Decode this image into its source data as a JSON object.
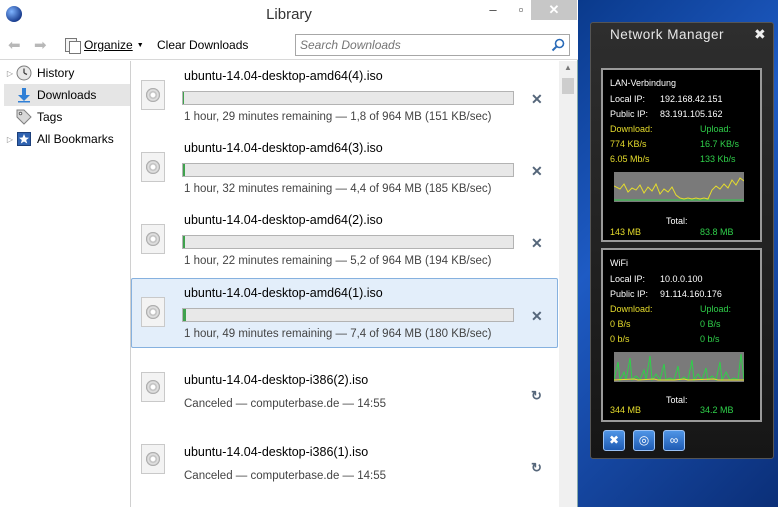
{
  "library": {
    "title": "Library",
    "window_controls": {
      "minimize": "–",
      "maximize": "▫",
      "close": "✕"
    },
    "toolbar": {
      "organize_label": "Organize",
      "clear_downloads_label": "Clear Downloads",
      "search_placeholder": "Search Downloads"
    },
    "sidebar": {
      "items": [
        {
          "label": "History",
          "icon": "history-clock-icon",
          "expandable": true,
          "selected": false
        },
        {
          "label": "Downloads",
          "icon": "download-arrow-icon",
          "expandable": false,
          "selected": true
        },
        {
          "label": "Tags",
          "icon": "tag-icon",
          "expandable": false,
          "selected": false
        },
        {
          "label": "All Bookmarks",
          "icon": "bookmark-star-icon",
          "expandable": true,
          "selected": false
        }
      ]
    },
    "downloads": [
      {
        "name": "ubuntu-14.04-desktop-amd64(4).iso",
        "status": "1 hour, 29 minutes remaining — 1,8 of 964 MB (151 KB/sec)",
        "progress": 0.002,
        "state": "active",
        "action": "cancel-icon"
      },
      {
        "name": "ubuntu-14.04-desktop-amd64(3).iso",
        "status": "1 hour, 32 minutes remaining — 4,4 of 964 MB (185 KB/sec)",
        "progress": 0.005,
        "state": "active",
        "action": "cancel-icon"
      },
      {
        "name": "ubuntu-14.04-desktop-amd64(2).iso",
        "status": "1 hour, 22 minutes remaining — 5,2 of 964 MB (194 KB/sec)",
        "progress": 0.005,
        "state": "active",
        "action": "cancel-icon"
      },
      {
        "name": "ubuntu-14.04-desktop-amd64(1).iso",
        "status": "1 hour, 49 minutes remaining — 7,4 of 964 MB (180 KB/sec)",
        "progress": 0.008,
        "state": "active",
        "selected": true,
        "action": "cancel-icon"
      },
      {
        "name": "ubuntu-14.04-desktop-i386(2).iso",
        "status": "Canceled — computerbase.de — 14:55",
        "state": "canceled",
        "action": "retry-icon"
      },
      {
        "name": "ubuntu-14.04-desktop-i386(1).iso",
        "status": "Canceled — computerbase.de — 14:55",
        "state": "canceled",
        "action": "retry-icon"
      }
    ]
  },
  "network_manager": {
    "title": "Network Manager",
    "adapters": [
      {
        "name": "LAN-Verbindung",
        "local_ip_label": "Local IP:",
        "local_ip": "192.168.42.151",
        "public_ip_label": "Public IP:",
        "public_ip": "83.191.105.162",
        "download_label": "Download:",
        "upload_label": "Upload:",
        "download_kbs": "774 KB/s",
        "upload_kbs": "16.7 KB/s",
        "download_mbs": "6.05 Mb/s",
        "upload_mbs": "133 Kb/s",
        "total_label": "Total:",
        "total_down": "143 MB",
        "total_up": "83.8 MB"
      },
      {
        "name": "WiFi",
        "local_ip_label": "Local IP:",
        "local_ip": "10.0.0.100",
        "public_ip_label": "Public IP:",
        "public_ip": "91.114.160.176",
        "download_label": "Download:",
        "upload_label": "Upload:",
        "download_kbs": "0 B/s",
        "upload_kbs": "0 B/s",
        "download_mbs": "0 b/s",
        "upload_mbs": "0 b/s",
        "total_label": "Total:",
        "total_down": "344 MB",
        "total_up": "34.2 MB"
      }
    ],
    "buttons": [
      "tools-icon",
      "refresh-circle-icon",
      "network-link-icon"
    ],
    "colors": {
      "download": "#e6dd2c",
      "upload": "#2fd04a",
      "graph_bg": "#7a7a7a"
    }
  }
}
